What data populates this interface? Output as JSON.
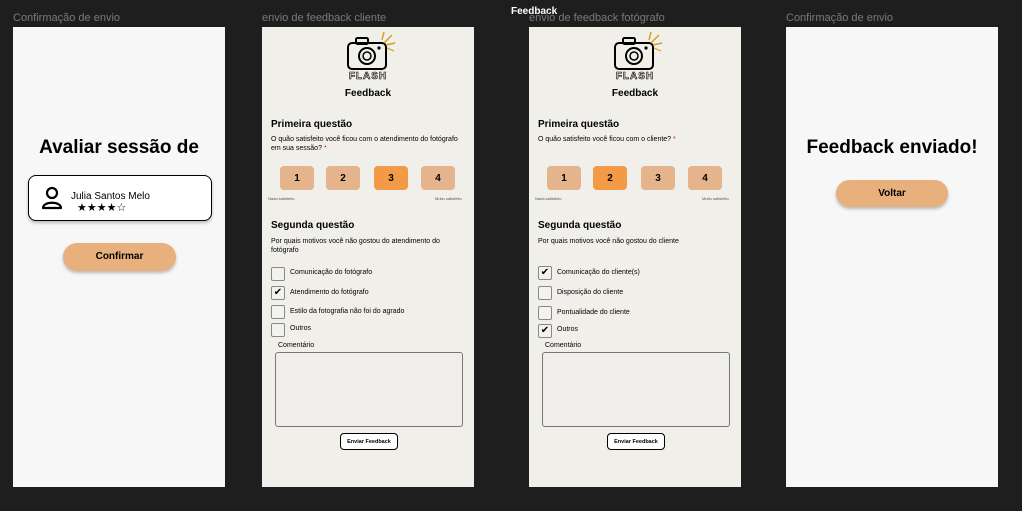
{
  "page_title": "Feedback",
  "frame_labels": [
    "Confirmação de envio",
    "envio de feedback cliente",
    "envio de feedback fotógrafo",
    "Confirmação de envio"
  ],
  "frame1": {
    "title": "Avaliar sessão de",
    "user_name": "Julia Santos Melo",
    "stars": "★★★★☆",
    "rating": 4,
    "confirm_label": "Confirmar"
  },
  "frame2": {
    "logo_text": "FLASH",
    "heading": "Feedback",
    "q1_title": "Primeira questão",
    "q1_text": "O quão satisfeito você ficou com o atendimento do fotógrafo em sua sessão?",
    "required_mark": "*",
    "scale": [
      "1",
      "2",
      "3",
      "4"
    ],
    "selected": "3",
    "scale_low": "Nada satisfeito",
    "scale_high": "Muito satisfeito",
    "q2_title": "Segunda questão",
    "q2_text": "Por quais motivos você não gostou do atendimento do fotógrafo",
    "options": [
      {
        "label": "Comunicação do fotógrafo",
        "checked": false
      },
      {
        "label": "Atendimento do fotógrafo",
        "checked": true
      },
      {
        "label": "Estilo da fotografia não foi do agrado",
        "checked": false
      },
      {
        "label": "Outros",
        "checked": false
      }
    ],
    "comment_label": "Comentário",
    "send_label": "Enviar Feedback"
  },
  "frame3": {
    "logo_text": "FLASH",
    "heading": "Feedback",
    "q1_title": "Primeira questão",
    "q1_text": "O quão satisfeito você ficou com o cliente?",
    "required_mark": "*",
    "scale": [
      "1",
      "2",
      "3",
      "4"
    ],
    "selected": "2",
    "scale_low": "Nada satisfeito",
    "scale_high": "Muito satisfeito",
    "q2_title": "Segunda questão",
    "q2_text": "Por quais motivos você não gostou do cliente",
    "options": [
      {
        "label": "Comunicação do cliente(s)",
        "checked": true
      },
      {
        "label": "Disposição do cliente",
        "checked": false
      },
      {
        "label": "Pontualidade do cliente",
        "checked": false
      },
      {
        "label": "Outros",
        "checked": true
      }
    ],
    "comment_label": "Comentário",
    "send_label": "Enviar Feedback"
  },
  "frame4": {
    "title": "Feedback enviado!",
    "back_label": "Voltar"
  },
  "colors": {
    "accent": "#e7b07c",
    "selected": "#f29a45",
    "unselected": "#e6b48c",
    "required": "#d61f1f"
  }
}
